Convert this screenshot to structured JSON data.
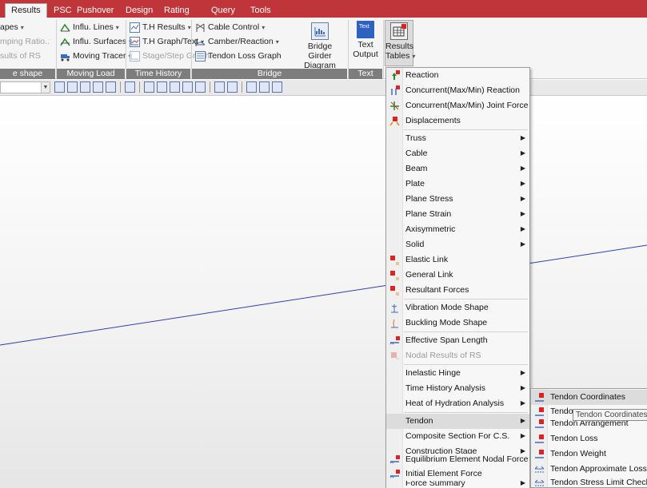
{
  "tabs": [
    "Results",
    "PSC",
    "Pushover",
    "Design",
    "Rating",
    "Query",
    "Tools"
  ],
  "active_tab": "Results",
  "ribbon": {
    "col1": [
      "apes",
      "mping Ratio..",
      "sults of RS"
    ],
    "col1_label": "e shape",
    "moving_load": {
      "items": [
        "Influ. Lines",
        "Influ. Surfaces",
        "Moving Tracer"
      ],
      "label": "Moving Load"
    },
    "time_history": {
      "items": [
        "T.H Results",
        "T.H Graph/Text",
        "Stage/Step Graph"
      ],
      "label": "Time History"
    },
    "bridge": {
      "items": [
        "Cable Control",
        "Camber/Reaction",
        "Tendon Loss Graph"
      ],
      "big_button": [
        "Bridge Girder",
        "Diagram"
      ],
      "label": "Bridge"
    },
    "text": {
      "big_button": [
        "Text",
        "Output"
      ],
      "icon_text": "Text",
      "label": "Text"
    },
    "results_tables": [
      "Results",
      "Tables"
    ]
  },
  "menu": {
    "items": [
      {
        "label": "Reaction",
        "submenu": false
      },
      {
        "label": "Concurrent(Max/Min) Reaction",
        "submenu": false
      },
      {
        "label": "Concurrent(Max/Min) Joint Force",
        "submenu": false
      },
      {
        "label": "Displacements",
        "submenu": false
      },
      {
        "label": "Truss",
        "submenu": true
      },
      {
        "label": "Cable",
        "submenu": true
      },
      {
        "label": "Beam",
        "submenu": true
      },
      {
        "label": "Plate",
        "submenu": true
      },
      {
        "label": "Plane Stress",
        "submenu": true
      },
      {
        "label": "Plane Strain",
        "submenu": true
      },
      {
        "label": "Axisymmetric",
        "submenu": true
      },
      {
        "label": "Solid",
        "submenu": true
      },
      {
        "label": "Elastic Link",
        "submenu": false
      },
      {
        "label": "General Link",
        "submenu": false
      },
      {
        "label": "Resultant Forces",
        "submenu": false
      },
      {
        "label": "Vibration Mode Shape",
        "submenu": false
      },
      {
        "label": "Buckling Mode Shape",
        "submenu": false
      },
      {
        "label": "Effective Span Length",
        "submenu": false
      },
      {
        "label": "Nodal Results of RS",
        "submenu": false,
        "disabled": true
      },
      {
        "label": "Inelastic Hinge",
        "submenu": true
      },
      {
        "label": "Time History Analysis",
        "submenu": true
      },
      {
        "label": "Heat of Hydration Analysis",
        "submenu": true
      },
      {
        "label": "Tendon",
        "submenu": true,
        "hover": true
      },
      {
        "label": "Composite Section For C.S.",
        "submenu": true
      },
      {
        "label": "Construction Stage",
        "submenu": true
      },
      {
        "label": "Equilibrium Element Nodal Force",
        "submenu": false
      },
      {
        "label": "Initial Element Force",
        "submenu": false
      },
      {
        "label": "Force Summary",
        "submenu": true
      }
    ]
  },
  "tendon_submenu": {
    "items": [
      "Tendon Coordinates",
      "Tendon Elongation",
      "Tendon Arrangement",
      "Tendon Loss",
      "Tendon Weight",
      "Tendon Approximate Loss",
      "Tendon Stress Limit Check"
    ],
    "visible_label_2": "Tendon"
  },
  "tooltip": "Tendon Coordinates T",
  "colors": {
    "tabbar": "#c0353a",
    "menu_bg": "#f7f7f7",
    "hover": "#dcdcdc",
    "model_line": "#2d3fb5"
  }
}
